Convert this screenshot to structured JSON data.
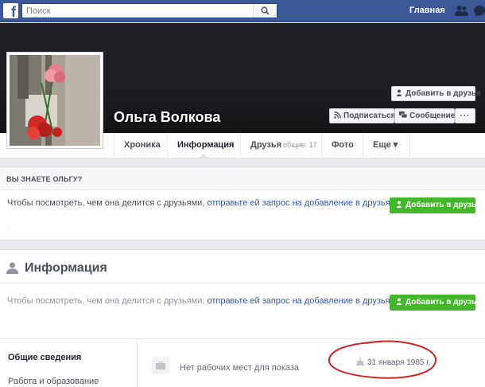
{
  "topbar": {
    "search_placeholder": "Поиск",
    "home_label": "Главная",
    "logo_letter": "f"
  },
  "cover": {
    "add_friend_label": "Добавить в друзья",
    "subscribe_label": "Подписаться",
    "message_label": "Сообщение",
    "more_label": "···"
  },
  "profile": {
    "name": "Ольга Волкова"
  },
  "tabs": [
    {
      "label": "Хроника"
    },
    {
      "label": "Информация",
      "active": true
    },
    {
      "label": "Друзья",
      "sub": "общие: 17"
    },
    {
      "label": "Фото"
    },
    {
      "label": "Еще ▾"
    }
  ],
  "know_card": {
    "title": "ВЫ ЗНАЕТЕ ОЛЬГУ?",
    "notice_prefix": "Чтобы посмотреть, чем она делится с друзьями, ",
    "notice_link": "отправьте ей запрос на добавление в друзья.",
    "button_label": "Добавить в друзья",
    "dot": "."
  },
  "info_card": {
    "title": "Информация",
    "notice_prefix": "Чтобы посмотреть, чем она делится с друзьями, ",
    "notice_link": "отправьте ей запрос на добавление в друзья.",
    "button_label": "Добавить в друзья",
    "side_links": [
      "Общие сведения",
      "Работа и образование"
    ],
    "no_work": "Нет рабочих мест для показа",
    "birthday": "31 января 1985 г."
  },
  "colors": {
    "topbar": "#3b5998",
    "link": "#365899",
    "green_button": "#42b72a",
    "annotation_circle": "#c62828"
  }
}
